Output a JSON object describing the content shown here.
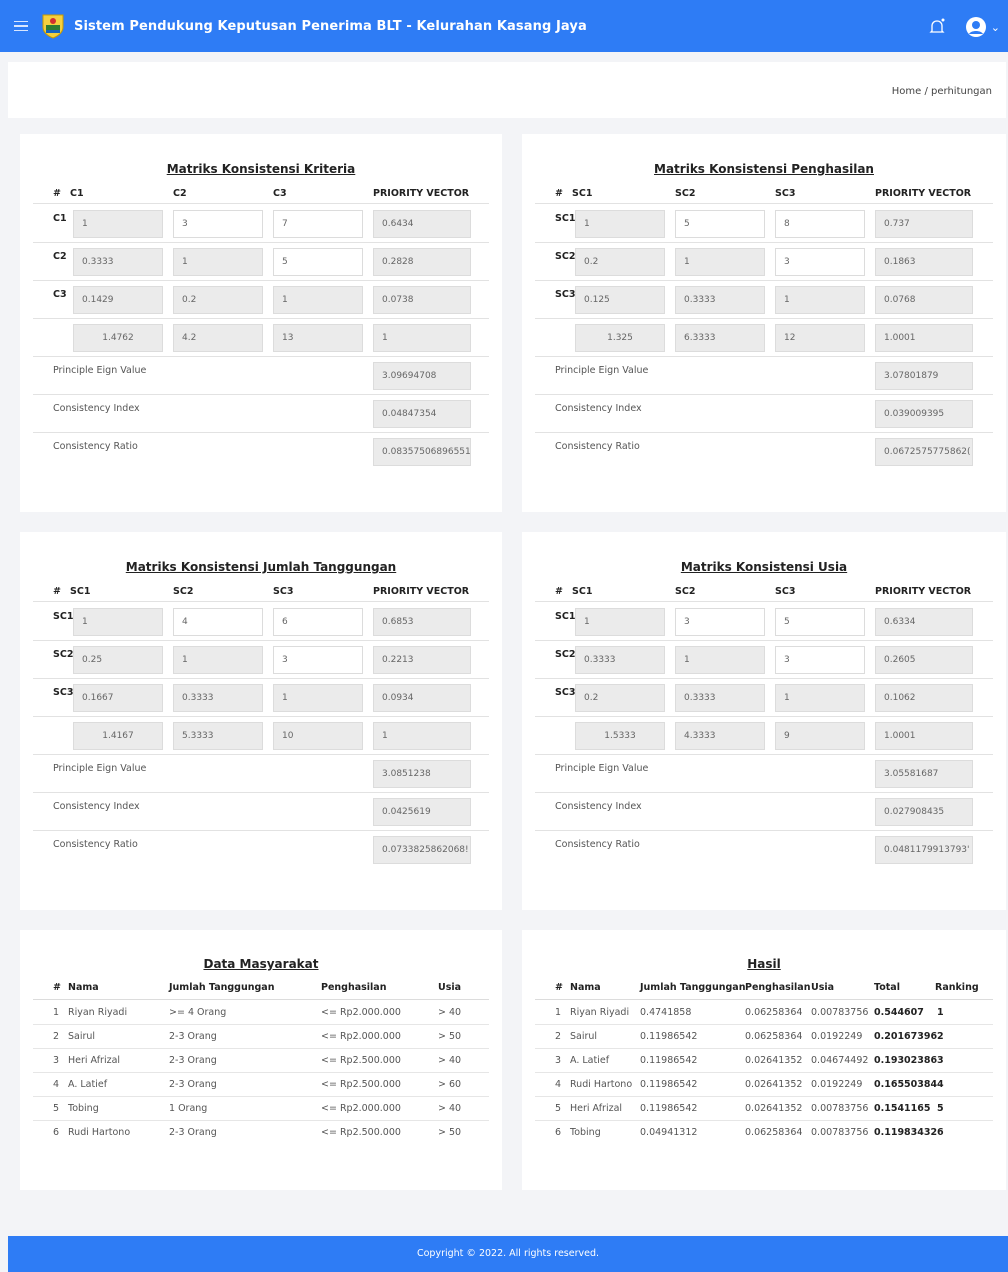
{
  "app": {
    "title": "Sistem Pendukung Keputusan Penerima BLT - Kelurahan Kasang Jaya"
  },
  "breadcrumb": "Home / perhitungan",
  "colors": {
    "primary": "#2e7cf5",
    "cell_readonly": "#ebebeb"
  },
  "icons": {
    "menu": "hamburger-icon",
    "logo": "regional-emblem-icon",
    "notify": "bell-icon",
    "user": "user-avatar-icon",
    "dropdown": "chevron-down-icon"
  },
  "matrices": [
    {
      "title": "Matriks Konsistensi Kriteria",
      "headers": [
        "#",
        "C1",
        "C2",
        "C3",
        "PRIORITY VECTOR"
      ],
      "rows": [
        {
          "label": "C1",
          "values": [
            "1",
            "3",
            "7"
          ],
          "pv": "0.6434"
        },
        {
          "label": "C2",
          "values": [
            "0.3333",
            "1",
            "5"
          ],
          "pv": "0.2828"
        },
        {
          "label": "C3",
          "values": [
            "0.1429",
            "0.2",
            "1"
          ],
          "pv": "0.0738"
        }
      ],
      "totals": [
        "1.4762",
        "4.2",
        "13",
        "1"
      ],
      "eigen_label": "Principle Eign Value",
      "eigen": "3.09694708",
      "ci_label": "Consistency Index",
      "ci": "0.04847354",
      "cr_label": "Consistency Ratio",
      "cr": "0.08357506896551"
    },
    {
      "title": "Matriks Konsistensi Penghasilan",
      "headers": [
        "#",
        "SC1",
        "SC2",
        "SC3",
        "PRIORITY VECTOR"
      ],
      "rows": [
        {
          "label": "SC1",
          "values": [
            "1",
            "5",
            "8"
          ],
          "pv": "0.737"
        },
        {
          "label": "SC2",
          "values": [
            "0.2",
            "1",
            "3"
          ],
          "pv": "0.1863"
        },
        {
          "label": "SC3",
          "values": [
            "0.125",
            "0.3333",
            "1"
          ],
          "pv": "0.0768"
        }
      ],
      "totals": [
        "1.325",
        "6.3333",
        "12",
        "1.0001"
      ],
      "eigen_label": "Principle Eign Value",
      "eigen": "3.07801879",
      "ci_label": "Consistency Index",
      "ci": "0.039009395",
      "cr_label": "Consistency Ratio",
      "cr": "0.0672575775862("
    },
    {
      "title": "Matriks Konsistensi Jumlah Tanggungan",
      "headers": [
        "#",
        "SC1",
        "SC2",
        "SC3",
        "PRIORITY VECTOR"
      ],
      "rows": [
        {
          "label": "SC1",
          "values": [
            "1",
            "4",
            "6"
          ],
          "pv": "0.6853"
        },
        {
          "label": "SC2",
          "values": [
            "0.25",
            "1",
            "3"
          ],
          "pv": "0.2213"
        },
        {
          "label": "SC3",
          "values": [
            "0.1667",
            "0.3333",
            "1"
          ],
          "pv": "0.0934"
        }
      ],
      "totals": [
        "1.4167",
        "5.3333",
        "10",
        "1"
      ],
      "eigen_label": "Principle Eign Value",
      "eigen": "3.0851238",
      "ci_label": "Consistency Index",
      "ci": "0.0425619",
      "cr_label": "Consistency Ratio",
      "cr": "0.0733825862068!"
    },
    {
      "title": "Matriks Konsistensi Usia",
      "headers": [
        "#",
        "SC1",
        "SC2",
        "SC3",
        "PRIORITY VECTOR"
      ],
      "rows": [
        {
          "label": "SC1",
          "values": [
            "1",
            "3",
            "5"
          ],
          "pv": "0.6334"
        },
        {
          "label": "SC2",
          "values": [
            "0.3333",
            "1",
            "3"
          ],
          "pv": "0.2605"
        },
        {
          "label": "SC3",
          "values": [
            "0.2",
            "0.3333",
            "1"
          ],
          "pv": "0.1062"
        }
      ],
      "totals": [
        "1.5333",
        "4.3333",
        "9",
        "1.0001"
      ],
      "eigen_label": "Principle Eign Value",
      "eigen": "3.05581687",
      "ci_label": "Consistency Index",
      "ci": "0.027908435",
      "cr_label": "Consistency Ratio",
      "cr": "0.0481179913793'"
    }
  ],
  "masyarakat": {
    "title": "Data Masyarakat",
    "headers": [
      "#",
      "Nama",
      "Jumlah Tanggungan",
      "Penghasilan",
      "Usia"
    ],
    "rows": [
      [
        "1",
        "Riyan Riyadi",
        ">= 4 Orang",
        "<= Rp2.000.000",
        "> 40"
      ],
      [
        "2",
        "Sairul",
        "2-3 Orang",
        "<= Rp2.000.000",
        "> 50"
      ],
      [
        "3",
        "Heri Afrizal",
        "2-3 Orang",
        "<= Rp2.500.000",
        "> 40"
      ],
      [
        "4",
        "A. Latief",
        "2-3 Orang",
        "<= Rp2.500.000",
        "> 60"
      ],
      [
        "5",
        "Tobing",
        "1 Orang",
        "<= Rp2.000.000",
        "> 40"
      ],
      [
        "6",
        "Rudi Hartono",
        "2-3 Orang",
        "<= Rp2.500.000",
        "> 50"
      ]
    ]
  },
  "hasil": {
    "title": "Hasil",
    "headers": [
      "#",
      "Nama",
      "Jumlah Tanggungan",
      "Penghasilan",
      "Usia",
      "Total",
      "Ranking"
    ],
    "rows": [
      [
        "1",
        "Riyan Riyadi",
        "0.4741858",
        "0.06258364",
        "0.00783756",
        "0.544607",
        "1"
      ],
      [
        "2",
        "Sairul",
        "0.11986542",
        "0.06258364",
        "0.0192249",
        "0.20167396",
        "2"
      ],
      [
        "3",
        "A. Latief",
        "0.11986542",
        "0.02641352",
        "0.04674492",
        "0.19302386",
        "3"
      ],
      [
        "4",
        "Rudi Hartono",
        "0.11986542",
        "0.02641352",
        "0.0192249",
        "0.16550384",
        "4"
      ],
      [
        "5",
        "Heri Afrizal",
        "0.11986542",
        "0.02641352",
        "0.00783756",
        "0.1541165",
        "5"
      ],
      [
        "6",
        "Tobing",
        "0.04941312",
        "0.06258364",
        "0.00783756",
        "0.11983432",
        "6"
      ]
    ]
  },
  "footer": "Copyright © 2022. All rights reserved."
}
